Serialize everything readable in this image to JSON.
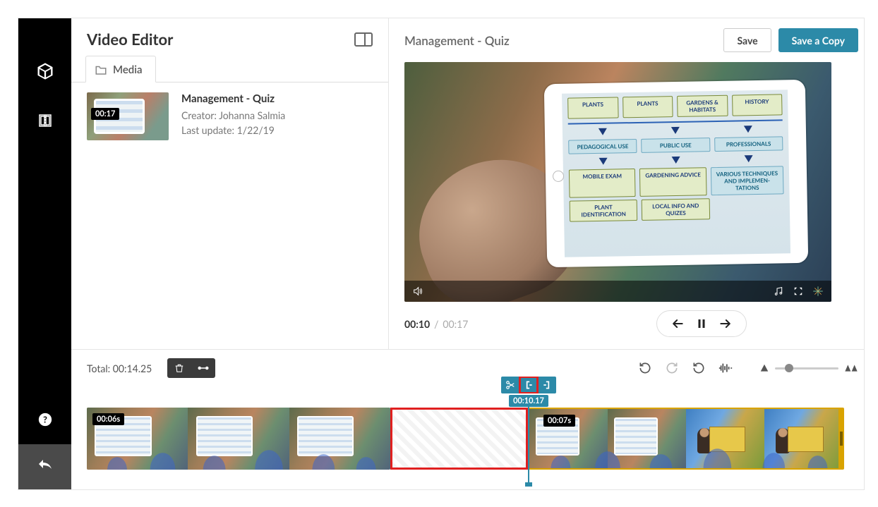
{
  "sidebar": {
    "items": [
      "package",
      "timeline-edit"
    ],
    "help": "help",
    "back": "back"
  },
  "leftPane": {
    "title": "Video Editor",
    "tabs": {
      "media": "Media"
    },
    "mediaItems": [
      {
        "title": "Management - Quiz",
        "creator_label": "Creator: Johanna Salmia",
        "updated_label": "Last update: 1/22/19",
        "duration": "00:17"
      }
    ]
  },
  "preview": {
    "title": "Management - Quiz",
    "save_label": "Save",
    "save_copy_label": "Save a Copy",
    "current_time": "00:10",
    "total_time": "00:17",
    "ipad_diagram": {
      "row1": [
        "PLANTS",
        "PLANTS",
        "GARDENS & HABITATS",
        "HISTORY"
      ],
      "row2": [
        "PEDAGOGICAL USE",
        "PUBLIC USE",
        "PROFESSIONALS"
      ],
      "row3": [
        "MOBILE EXAM",
        "GARDENING ADVICE",
        "VARIOUS TECHNIQUES AND IMPLEMEN- TATIONS"
      ],
      "row4": [
        "PLANT IDENTIFICATION",
        "LOCAL INFO AND QUIZES"
      ]
    }
  },
  "timeline": {
    "total_label": "Total: 00:14.25",
    "cut_time": "00:10.17",
    "clip1_duration": "00:06s",
    "clip2_duration": "00:07s"
  }
}
